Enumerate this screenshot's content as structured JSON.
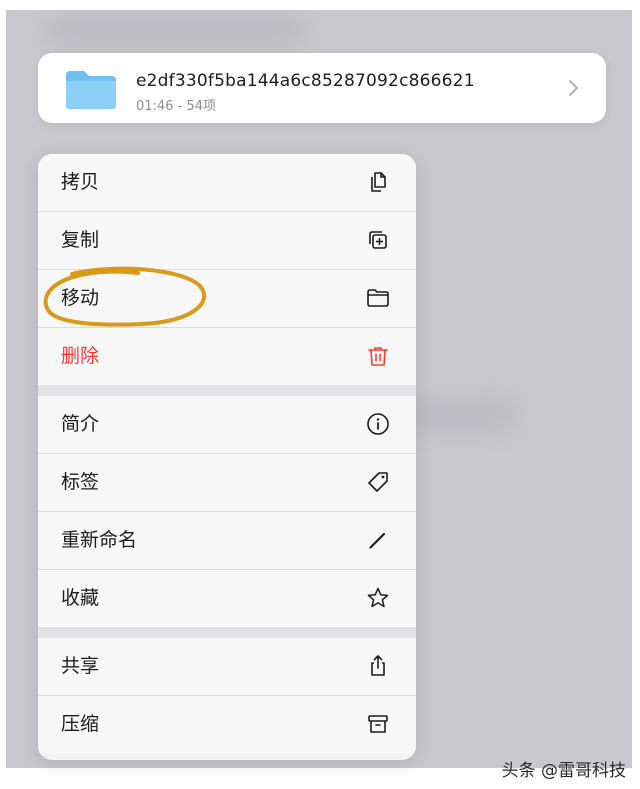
{
  "file": {
    "name": "e2df330f5ba144a6c85287092c866621",
    "meta": "01:46 - 54项",
    "folder_color": "#6fc1f3"
  },
  "menu": {
    "groups": [
      [
        {
          "label": "拷贝",
          "icon": "copy-documents-icon"
        },
        {
          "label": "复制",
          "icon": "duplicate-plus-icon"
        },
        {
          "label": "移动",
          "icon": "folder-icon"
        },
        {
          "label": "删除",
          "icon": "trash-icon",
          "destructive": true
        }
      ],
      [
        {
          "label": "简介",
          "icon": "info-icon"
        },
        {
          "label": "标签",
          "icon": "tag-icon"
        },
        {
          "label": "重新命名",
          "icon": "pencil-icon"
        },
        {
          "label": "收藏",
          "icon": "star-icon"
        }
      ],
      [
        {
          "label": "共享",
          "icon": "share-icon"
        },
        {
          "label": "压缩",
          "icon": "archive-box-icon"
        }
      ]
    ]
  },
  "annotation": {
    "color": "#d99a1a",
    "target": "移动"
  },
  "colors": {
    "destructive": "#ff3b30",
    "icon": "#1c1c1e"
  },
  "watermark": "头条 @雷哥科技"
}
